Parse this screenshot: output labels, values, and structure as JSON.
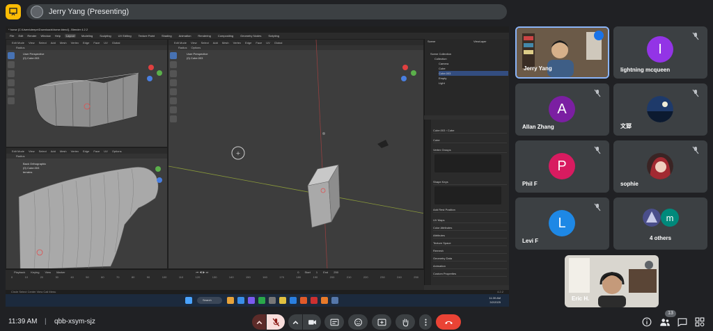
{
  "header": {
    "present_icon": "presentation-icon",
    "presenter": "Jerry Yang (Presenting)"
  },
  "shared_screen": {
    "window_title": "* horse [C:\\Users\\deepe\\Downloads\\horse.blend] - Blender 4.2.2",
    "menu": [
      "File",
      "Edit",
      "Render",
      "Window",
      "Help"
    ],
    "workspace_tabs": [
      "Layout",
      "Modeling",
      "Sculpting",
      "UV Editing",
      "Texture Paint",
      "Shading",
      "Animation",
      "Rendering",
      "Compositing",
      "Geometry Nodes",
      "Scripting"
    ],
    "active_workspace": "Layout",
    "viewport_header": [
      "Edit Mode",
      "View",
      "Select",
      "Add",
      "Mesh",
      "Vertex",
      "Edge",
      "Face",
      "UV"
    ],
    "transform": "Global",
    "radius_label": "Radius",
    "options_label": "Options",
    "viewport_top_left": {
      "line1": "User Perspective",
      "line2": "(0) Cube.003"
    },
    "viewport_bottom_left": {
      "line1": "Back Orthographic",
      "line2": "(0) Cube.003",
      "line3": "terrains"
    },
    "viewport_main": {
      "line1": "User Perspective",
      "line2": "(0) Cube.003"
    },
    "outliner": {
      "scene": "Scene",
      "view_layer": "ViewLayer",
      "rows": [
        "Scene Collection",
        "Collection",
        "Camera",
        "Cube",
        "Cube.003",
        "Empty",
        "Light"
      ],
      "selected": "Cube.003"
    },
    "properties": {
      "object": "Cube.003",
      "mesh": "Cube",
      "sections": [
        "Vertex Groups",
        "Shape Keys",
        "Add Rest Position",
        "UV Maps",
        "Color Attributes",
        "Attributes",
        "Texture Space",
        "Remesh",
        "Geometry Data",
        "Animation",
        "Custom Properties"
      ]
    },
    "timeline": {
      "menu": [
        "Playback",
        "Keying",
        "View",
        "Marker"
      ],
      "ticks": [
        "0",
        "10",
        "20",
        "30",
        "40",
        "50",
        "60",
        "70",
        "80",
        "90",
        "100",
        "110",
        "120",
        "130",
        "140",
        "150",
        "160",
        "170",
        "180",
        "190",
        "200",
        "210",
        "220",
        "230",
        "240",
        "250"
      ],
      "current_frame": "0",
      "start_label": "Start",
      "start": "1",
      "end_label": "End",
      "end": "250"
    },
    "status_bar": "Circle Select   Center View   Call Menu",
    "version": "4.2.2",
    "taskbar": {
      "search": "Search",
      "time": "11:39 AM",
      "date": "3/2/2025"
    }
  },
  "participants": [
    {
      "name": "Jerry Yang",
      "initial": "",
      "color": "#5b4a3a",
      "speaking": true,
      "kind": "video-jerry"
    },
    {
      "name": "lightning mcqueen",
      "initial": "I",
      "color": "#9334e6",
      "kind": "initial"
    },
    {
      "name": "Allan Zhang",
      "initial": "A",
      "color": "#7b1fa2",
      "kind": "initial"
    },
    {
      "name": "文郅",
      "initial": "",
      "color": "#14274a",
      "kind": "photo-moon"
    },
    {
      "name": "Phil F",
      "initial": "P",
      "color": "#d81b60",
      "kind": "initial"
    },
    {
      "name": "sophie",
      "initial": "",
      "color": "#3a2b2b",
      "kind": "photo-anime"
    },
    {
      "name": "Levi F",
      "initial": "L",
      "color": "#1e88e5",
      "kind": "initial"
    },
    {
      "name": "4 others",
      "initial": "m",
      "color": "#00897b",
      "kind": "others"
    }
  ],
  "self_view": {
    "name": "Eric H."
  },
  "bottom_bar": {
    "time": "11:39 AM",
    "separator": "|",
    "meeting_code": "qbb-xsym-sjz",
    "participant_count": "13",
    "colors": {
      "accent": "#8ab4f8",
      "danger": "#ea4335",
      "mic_off": "#f9dedc"
    }
  }
}
